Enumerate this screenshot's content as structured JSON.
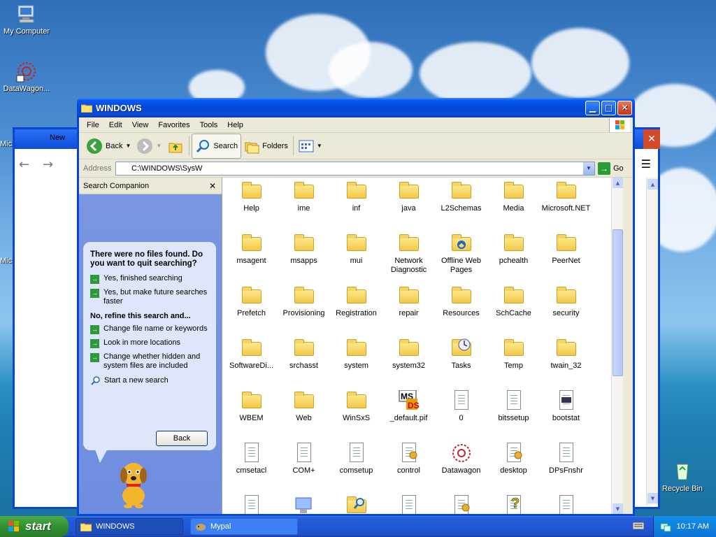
{
  "desktop": {
    "icons": [
      {
        "label": "My Computer",
        "icon": "my-computer-icon"
      },
      {
        "label": "DataWagon...",
        "icon": "datawagon-icon"
      },
      {
        "label": "Recycle Bin",
        "icon": "recycle-bin-icon"
      }
    ],
    "partial_labels": [
      "Mic",
      "Mic"
    ]
  },
  "background_window": {
    "tab_label": "New"
  },
  "window": {
    "title": "WINDOWS",
    "controls": [
      "minimize",
      "maximize",
      "close"
    ]
  },
  "menubar": {
    "items": [
      "File",
      "Edit",
      "View",
      "Favorites",
      "Tools",
      "Help"
    ]
  },
  "toolbar": {
    "back_label": "Back",
    "search_label": "Search",
    "folders_label": "Folders"
  },
  "addressbar": {
    "label": "Address",
    "value": "C:\\WINDOWS\\SysW",
    "go_label": "Go"
  },
  "companion": {
    "header": "Search Companion",
    "question": "There were no files found. Do you want to quit searching?",
    "options_quit": [
      "Yes, finished searching",
      "Yes, but make future searches faster"
    ],
    "refine_heading": "No, refine this search and...",
    "options_refine": [
      "Change file name or keywords",
      "Look in more locations",
      "Change whether hidden and system files are included"
    ],
    "new_search": "Start a new search",
    "back_button": "Back"
  },
  "files": {
    "items": [
      {
        "name": "Help",
        "type": "folder"
      },
      {
        "name": "ime",
        "type": "folder"
      },
      {
        "name": "inf",
        "type": "folder"
      },
      {
        "name": "java",
        "type": "folder"
      },
      {
        "name": "L2Schemas",
        "type": "folder"
      },
      {
        "name": "Media",
        "type": "folder"
      },
      {
        "name": "Microsoft.NET",
        "type": "folder"
      },
      {
        "name": "msagent",
        "type": "folder"
      },
      {
        "name": "msapps",
        "type": "folder"
      },
      {
        "name": "mui",
        "type": "folder"
      },
      {
        "name": "Network Diagnostic",
        "type": "folder"
      },
      {
        "name": "Offline Web Pages",
        "type": "special-folder"
      },
      {
        "name": "pchealth",
        "type": "folder"
      },
      {
        "name": "PeerNet",
        "type": "folder"
      },
      {
        "name": "Prefetch",
        "type": "folder"
      },
      {
        "name": "Provisioning",
        "type": "folder"
      },
      {
        "name": "Registration",
        "type": "folder"
      },
      {
        "name": "repair",
        "type": "folder"
      },
      {
        "name": "Resources",
        "type": "folder"
      },
      {
        "name": "SchCache",
        "type": "folder"
      },
      {
        "name": "security",
        "type": "folder"
      },
      {
        "name": "SoftwareDi...",
        "type": "folder"
      },
      {
        "name": "srchasst",
        "type": "folder"
      },
      {
        "name": "system",
        "type": "folder"
      },
      {
        "name": "system32",
        "type": "folder"
      },
      {
        "name": "Tasks",
        "type": "tasks-folder"
      },
      {
        "name": "Temp",
        "type": "folder"
      },
      {
        "name": "twain_32",
        "type": "folder"
      },
      {
        "name": "WBEM",
        "type": "folder"
      },
      {
        "name": "Web",
        "type": "folder"
      },
      {
        "name": "WinSxS",
        "type": "folder"
      },
      {
        "name": "_default.pif",
        "type": "pif"
      },
      {
        "name": "0",
        "type": "document"
      },
      {
        "name": "bitssetup",
        "type": "document"
      },
      {
        "name": "bootstat",
        "type": "binary"
      },
      {
        "name": "cmsetacl",
        "type": "document"
      },
      {
        "name": "COM+",
        "type": "document"
      },
      {
        "name": "comsetup",
        "type": "document"
      },
      {
        "name": "control",
        "type": "config"
      },
      {
        "name": "Datawagon",
        "type": "datawagon"
      },
      {
        "name": "desktop",
        "type": "config"
      },
      {
        "name": "DPsFnshr",
        "type": "document"
      },
      {
        "name": "",
        "type": "document"
      },
      {
        "name": "",
        "type": "app"
      },
      {
        "name": "",
        "type": "search"
      },
      {
        "name": "",
        "type": "document"
      },
      {
        "name": "",
        "type": "config"
      },
      {
        "name": "",
        "type": "help"
      },
      {
        "name": "",
        "type": "document"
      }
    ]
  },
  "taskbar": {
    "start_label": "start",
    "tasks": [
      {
        "label": "WINDOWS",
        "active": true
      },
      {
        "label": "Mypal",
        "active": false
      }
    ],
    "clock": "10:17 AM"
  },
  "colors": {
    "titlebar": "#0047d9",
    "taskbar": "#245edb",
    "start": "#3a9a3a",
    "companion": "#7a96e0"
  }
}
